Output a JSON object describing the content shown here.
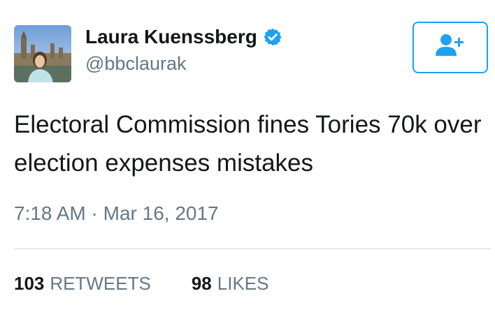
{
  "tweet": {
    "author": {
      "display_name": "Laura Kuenssberg",
      "handle": "@bbclaurak",
      "verified": true,
      "avatar_icon": "profile-photo"
    },
    "follow_button_icon": "add-user-icon",
    "text": "Electoral Commission fines Tories 70k over election expenses mistakes",
    "time": "7:18 AM",
    "separator": "·",
    "date": "Mar 16, 2017",
    "stats": {
      "retweets_count": "103",
      "retweets_label": "RETWEETS",
      "likes_count": "98",
      "likes_label": "LIKES"
    }
  },
  "colors": {
    "accent": "#1da1f2",
    "text_primary": "#14171a",
    "text_secondary": "#657786",
    "divider": "#ccd6dd"
  }
}
